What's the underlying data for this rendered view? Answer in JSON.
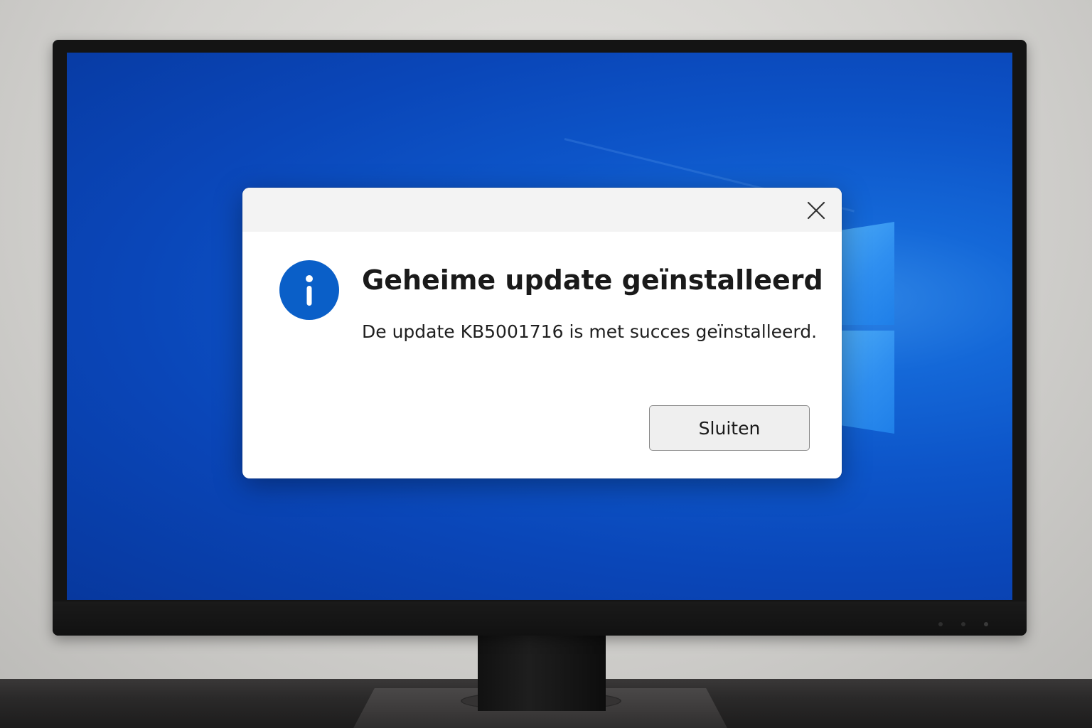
{
  "dialog": {
    "title": "Geheime update geïnstalleerd",
    "message": "De update KB5001716 is met succes geïnstalleerd.",
    "primary_button_label": "Sluiten",
    "icons": {
      "info": "info-icon",
      "close": "close-icon"
    }
  },
  "desktop": {
    "wallpaper": "windows-logo",
    "accent_color": "#0a5fc8"
  }
}
